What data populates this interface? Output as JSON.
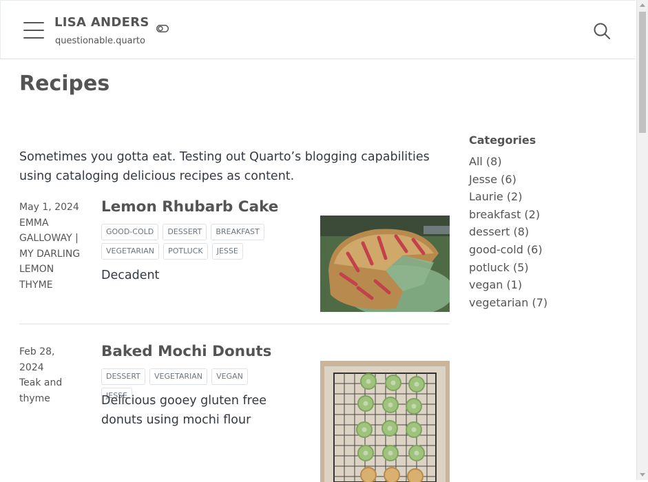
{
  "navbar": {
    "title": "LISA ANDERS",
    "subtitle": "questionable.quarto",
    "icons": [
      "menu-icon",
      "toggle-icon",
      "search-icon"
    ]
  },
  "page": {
    "title": "Recipes",
    "intro": "Sometimes you gotta eat. Testing out Quarto’s blogging capabilities using cataloging delicious recipes as content."
  },
  "posts": [
    {
      "date": "May 1, 2024",
      "author": "EMMA GALLOWAY | MY DARLING LEMON THYME",
      "title": "Lemon Rhubarb Cake",
      "categories": [
        "GOOD-COLD",
        "DESSERT",
        "BREAKFAST",
        "VEGETARIAN",
        "POTLUCK",
        "JESSE"
      ],
      "description": "Decadent"
    },
    {
      "date": "Feb 28, 2024",
      "author": "Teak and thyme",
      "title": "Baked Mochi Donuts",
      "categories": [
        "DESSERT",
        "VEGETARIAN",
        "VEGAN",
        "JESSE"
      ],
      "description": "Delicious gooey gluten free donuts using mochi flour"
    }
  ],
  "sidebar": {
    "heading": "Categories",
    "items": [
      "All (8)",
      "Jesse (6)",
      "Laurie (2)",
      "breakfast (2)",
      "dessert (8)",
      "good-cold (6)",
      "potluck (5)",
      "vegan (1)",
      "vegetarian (7)"
    ]
  },
  "colors": {
    "text": "#343a40",
    "heading": "#545454",
    "border": "#dee2e6",
    "muted": "#6c757d"
  }
}
